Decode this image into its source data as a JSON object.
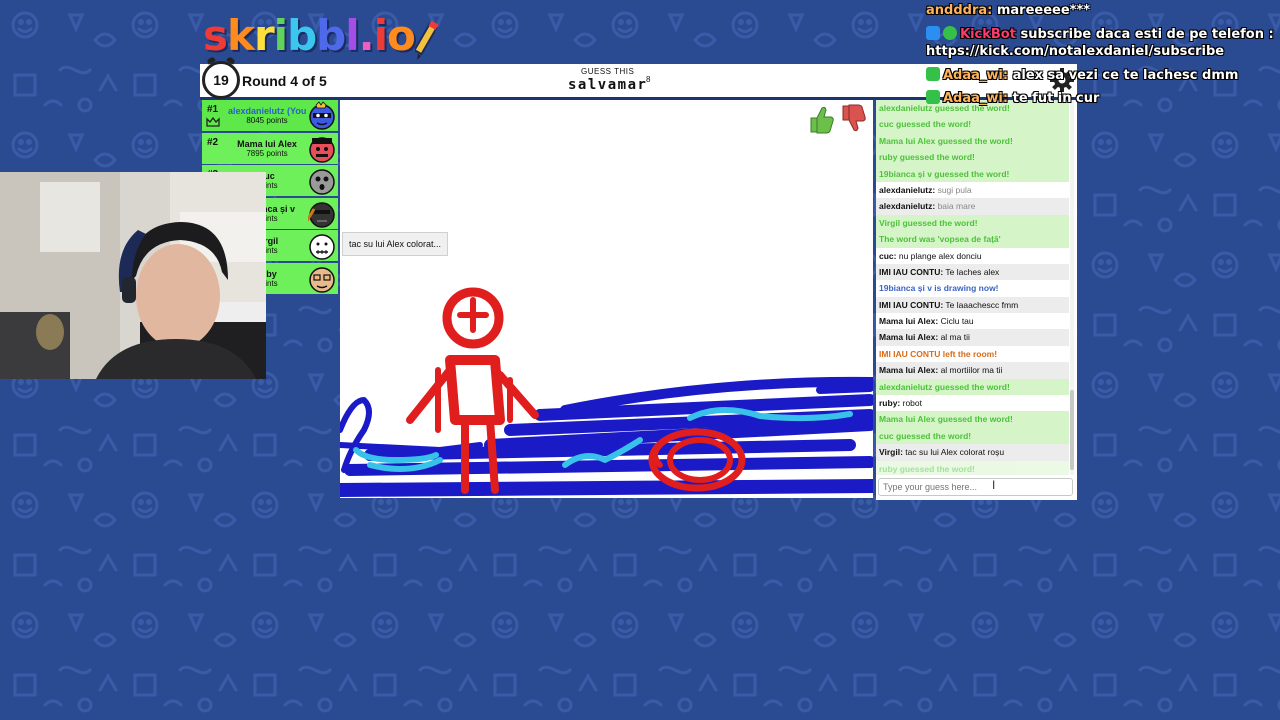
{
  "logo": {
    "text": "skribbl.io"
  },
  "topbar": {
    "timer": "19",
    "round": "Round 4 of 5",
    "guess_label": "GUESS THIS",
    "word": "salvamar",
    "word_length": "8"
  },
  "players": [
    {
      "rank": "#1",
      "name": "alexdanielutz (You)",
      "points": "8045 points",
      "is_you": true
    },
    {
      "rank": "#2",
      "name": "Mama lui Alex",
      "points": "7895 points"
    },
    {
      "rank": "#3",
      "name": "cuc",
      "points": "points"
    },
    {
      "rank": "#4",
      "name": "19bianca și v",
      "points": "points"
    },
    {
      "rank": "#5",
      "name": "Virgil",
      "points": "points"
    },
    {
      "rank": "#6",
      "name": "ruby",
      "points": "points"
    }
  ],
  "tooltip": "tac su lui Alex colorat...",
  "chat": {
    "messages": [
      {
        "type": "guessed",
        "text": "alexdanielutz guessed the word!"
      },
      {
        "type": "guessed",
        "text": "cuc guessed the word!"
      },
      {
        "type": "guessed",
        "text": "Mama lui Alex guessed the word!"
      },
      {
        "type": "guessed",
        "text": "ruby guessed the word!"
      },
      {
        "type": "guessed",
        "text": "19bianca și v guessed the word!"
      },
      {
        "type": "chat",
        "user": "alexdanielutz:",
        "text": " sugi pula",
        "dim": true
      },
      {
        "type": "chat",
        "user": "alexdanielutz:",
        "text": " baia mare",
        "dim": true
      },
      {
        "type": "guessed",
        "text": "Virgil guessed the word!"
      },
      {
        "type": "guessed",
        "text": "The word was 'vopsea de față'"
      },
      {
        "type": "chat",
        "user": "cuc:",
        "text": " nu plange alex donciu"
      },
      {
        "type": "chat",
        "user": "IMI IAU CONTU:",
        "text": " Te laches alex"
      },
      {
        "type": "drawing",
        "text": "19bianca și v is drawing now!"
      },
      {
        "type": "chat",
        "user": "IMI IAU CONTU:",
        "text": " Te laaachescc fmm"
      },
      {
        "type": "chat",
        "user": "Mama lui Alex:",
        "text": " Ciclu tau"
      },
      {
        "type": "chat",
        "user": "Mama lui Alex:",
        "text": " al ma tii"
      },
      {
        "type": "left",
        "text": "IMI IAU CONTU left the room!"
      },
      {
        "type": "chat",
        "user": "Mama lui Alex:",
        "text": " al mortiilor ma tii"
      },
      {
        "type": "guessed",
        "text": "alexdanielutz guessed the word!"
      },
      {
        "type": "chat",
        "user": "ruby:",
        "text": " robot"
      },
      {
        "type": "guessed",
        "text": "Mama lui Alex guessed the word!"
      },
      {
        "type": "guessed",
        "text": "cuc guessed the word!"
      },
      {
        "type": "chat",
        "user": "Virgil:",
        "text": " tac su lui Alex colorat roșu"
      },
      {
        "type": "guessed",
        "text": "ruby guessed the word!",
        "fade": true
      }
    ],
    "input_placeholder": "Type your guess here..."
  },
  "overlay": {
    "line1_user": "andddra:",
    "line1_text": " mareeeee***",
    "line2_user": "KickBot",
    "line2_text": " subscribe daca esti de pe telefon :",
    "line3_text": "https://kick.com/notalexdaniel/subscribe",
    "line4_user": "Adaa_wi:",
    "line4_text": " alex sa vezi ce te lachesc dmm",
    "line5_user": "Adaa_wi:",
    "line5_text": " te fut in cur"
  },
  "colors": {
    "background": "#2a4a92",
    "guessed_green": "#4ec13a",
    "drawing_blue": "#3a63c4",
    "left_orange": "#d96a16"
  }
}
